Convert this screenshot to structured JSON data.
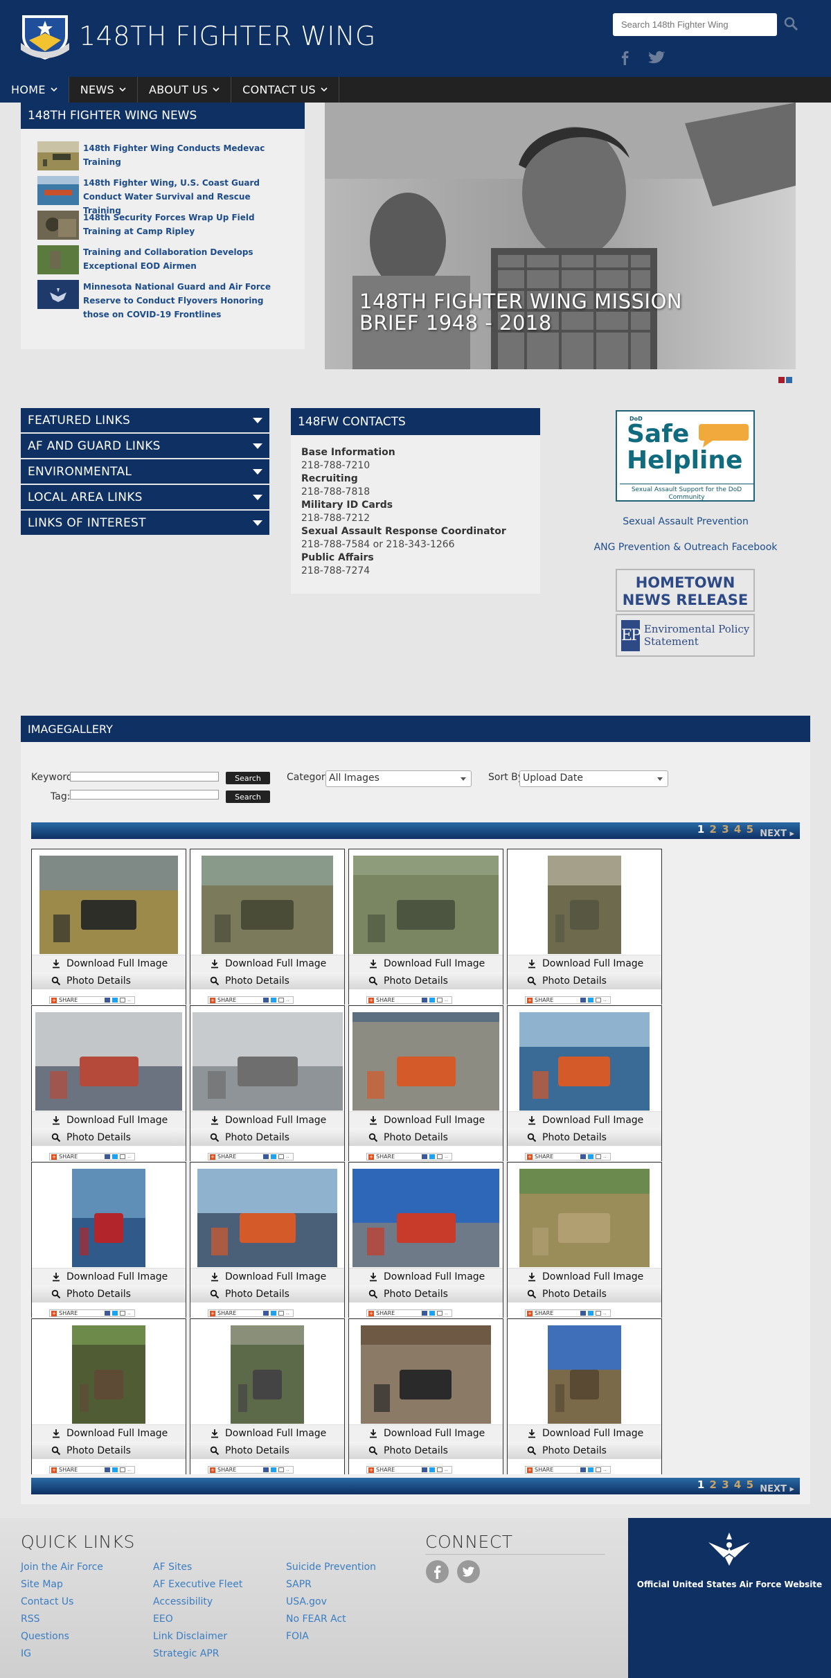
{
  "header": {
    "title": "148TH FIGHTER WING",
    "search_placeholder": "Search 148th Fighter Wing",
    "search_icon": "search-icon",
    "social": [
      "facebook-icon",
      "twitter-icon"
    ]
  },
  "nav": {
    "items": [
      {
        "label": "HOME"
      },
      {
        "label": "NEWS"
      },
      {
        "label": "ABOUT US"
      },
      {
        "label": "CONTACT US"
      }
    ]
  },
  "news": {
    "title": "148TH FIGHTER WING NEWS",
    "items": [
      {
        "label": "148th Fighter Wing Conducts Medevac Training"
      },
      {
        "label": "148th Fighter Wing, U.S. Coast Guard Conduct Water Survival and Rescue Training"
      },
      {
        "label": "148th Security Forces Wrap Up Field Training at Camp Ripley"
      },
      {
        "label": "Training and Collaboration Develops Exceptional EOD Airmen"
      },
      {
        "label": "Minnesota National Guard and Air Force Reserve to Conduct Flyovers Honoring those on COVID-19 Frontlines"
      }
    ]
  },
  "hero": {
    "caption": "148TH FIGHTER WING MISSION BRIEF 1948 - 2018"
  },
  "links": {
    "items": [
      {
        "label": "FEATURED LINKS"
      },
      {
        "label": "AF AND GUARD LINKS"
      },
      {
        "label": "ENVIRONMENTAL"
      },
      {
        "label": "LOCAL AREA LINKS"
      },
      {
        "label": "LINKS OF INTEREST"
      }
    ]
  },
  "contacts": {
    "title": "148FW CONTACTS",
    "entries": [
      {
        "label": "Base Information",
        "value": "218-788-7210"
      },
      {
        "label": "Recruiting",
        "value": "218-788-7818"
      },
      {
        "label": "Military ID Cards",
        "value": "218-788-7212"
      },
      {
        "label": "Sexual Assault Response Coordinator",
        "value": "218-788-7584 or 218-343-1266"
      },
      {
        "label": "Public Affairs",
        "value": "218-788-7274"
      }
    ]
  },
  "right": {
    "helpline": {
      "small": "DoD",
      "line1": "Safe",
      "line2": "Helpline",
      "tag": "Sexual Assault Support for the DoD Community"
    },
    "link1": "Sexual Assault Prevention",
    "link2": "ANG Prevention & Outreach Facebook",
    "hometown": "HOMETOWN NEWS RELEASE",
    "ep_logo": "EP",
    "ep_text": "Enviromental Policy Statement"
  },
  "gallery": {
    "title": "IMAGEGALLERY",
    "keyword_label": "Keyword:",
    "tag_label": "Tag:",
    "search_label": "Search",
    "category_label": "Category:",
    "category_value": "All Images",
    "sort_label": "Sort By:",
    "sort_value": "Upload Date",
    "pages": [
      "1",
      "2",
      "3",
      "4",
      "5"
    ],
    "next": "NEXT",
    "download_label": "Download Full Image",
    "details_label": "Photo Details",
    "share_label": "SHARE"
  },
  "footer": {
    "quick_title": "QUICK LINKS",
    "col1": [
      "Join the Air Force",
      "Site Map",
      "Contact Us",
      "RSS",
      "Questions",
      "IG"
    ],
    "col2": [
      "AF Sites",
      "AF Executive Fleet",
      "Accessibility",
      "EEO",
      "Link Disclaimer",
      "Strategic APR"
    ],
    "col3": [
      "Suicide Prevention",
      "SAPR",
      "USA.gov",
      "No FEAR Act",
      "FOIA"
    ],
    "connect_title": "CONNECT",
    "af_text": "Official United States Air Force Website"
  },
  "colors": {
    "brand_navy": "#0e3063",
    "nav_dark": "#222222",
    "link_blue": "#1d4c8c"
  }
}
